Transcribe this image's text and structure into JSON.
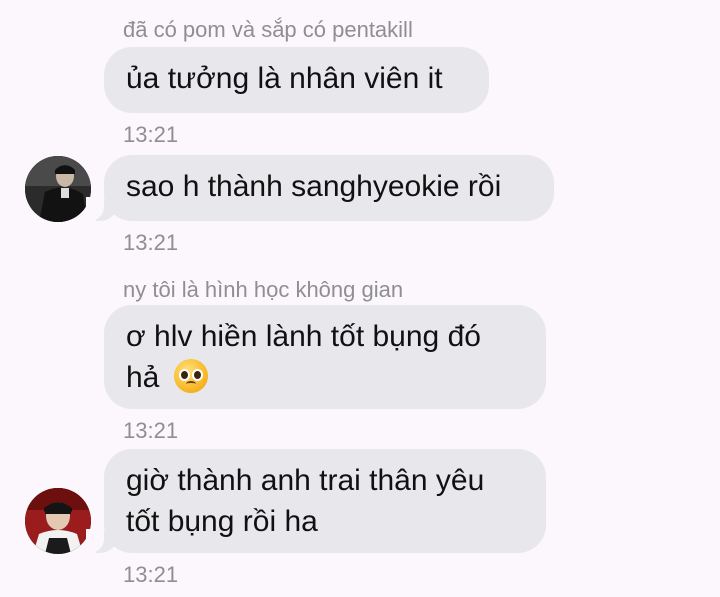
{
  "messages": [
    {
      "sender": "đã có pom và sắp có pentakill",
      "lines": [
        "ủa tưởng là nhân viên it"
      ],
      "time": "13:21"
    },
    {
      "lines": [
        "sao h thành sanghyeokie rồi"
      ],
      "time": "13:21",
      "avatar": "profile-photo-dark-coat"
    },
    {
      "sender": "ny tôi là hình học không gian",
      "lines": [
        "ơ hlv hiền lành tốt bụng đó",
        "hả"
      ],
      "emoji": "pleading-face-emoji",
      "time": "13:21"
    },
    {
      "lines": [
        "giờ thành anh trai thân yêu",
        "tốt bụng rồi ha"
      ],
      "time": "13:21",
      "avatar": "profile-photo-red-background"
    }
  ],
  "colors": {
    "background": "#fbf7fd",
    "bubble": "#e8e7ec",
    "meta_text": "#8e8e93",
    "message_text": "#111111"
  }
}
